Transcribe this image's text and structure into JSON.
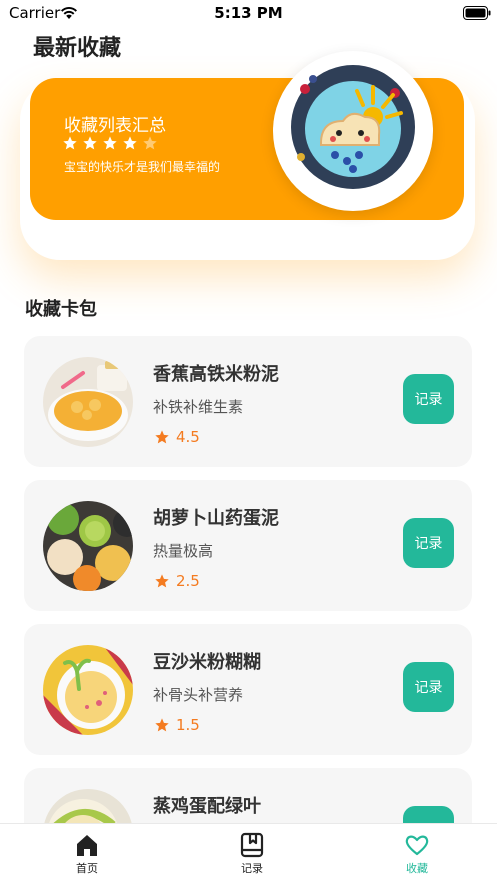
{
  "status_bar": {
    "carrier": "Carrier",
    "time": "5:13 PM"
  },
  "page_title": "最新收藏",
  "banner": {
    "title": "收藏列表汇总",
    "subtitle": "宝宝的快乐才是我们最幸福的",
    "rating": 4,
    "max_rating": 5,
    "accent_color": "#ff9f00"
  },
  "section_title": "收藏卡包",
  "cards": [
    {
      "title": "香蕉高铁米粉泥",
      "subtitle": "补铁补维生素",
      "rating": "4.5",
      "button_label": "记录"
    },
    {
      "title": "胡萝卜山药蛋泥",
      "subtitle": "热量极高",
      "rating": "2.5",
      "button_label": "记录"
    },
    {
      "title": "豆沙米粉糊糊",
      "subtitle": "补骨头补营养",
      "rating": "1.5",
      "button_label": "记录"
    },
    {
      "title": "蒸鸡蛋配绿叶",
      "subtitle": "",
      "rating": "",
      "button_label": "记录"
    }
  ],
  "tab_bar": {
    "items": [
      {
        "label": "首页",
        "icon": "home-icon"
      },
      {
        "label": "记录",
        "icon": "bookmark-book-icon"
      },
      {
        "label": "收藏",
        "icon": "heart-icon"
      }
    ],
    "active_index": 2,
    "active_color": "#23b89a"
  },
  "colors": {
    "record_button": "#23b89a",
    "rating_star": "#f47b20"
  }
}
